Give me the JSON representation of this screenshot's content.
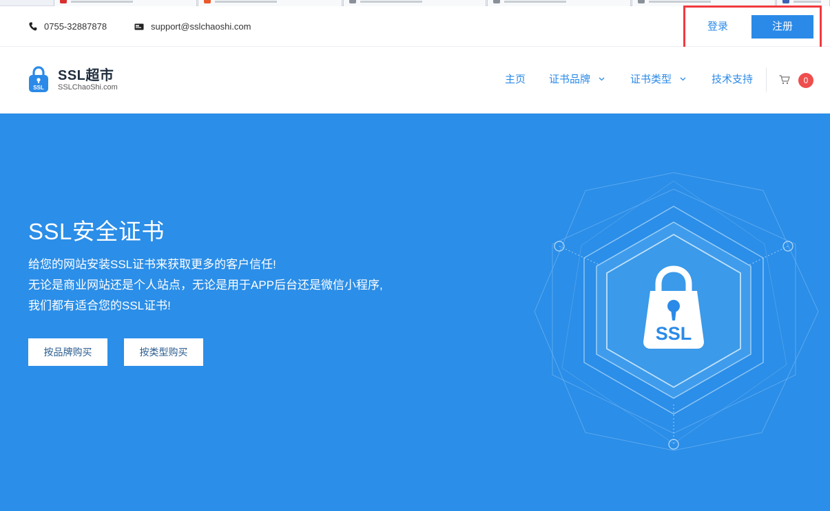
{
  "topbar": {
    "phone": "0755-32887878",
    "email": "support@sslchaoshi.com",
    "login_label": "登录",
    "register_label": "注册"
  },
  "brand": {
    "logo_badge": "SSL",
    "title": "SSL超市",
    "subtitle": "SSLChaoShi.com"
  },
  "nav": {
    "items": [
      {
        "label": "主页"
      },
      {
        "label": "证书品牌"
      },
      {
        "label": "证书类型"
      },
      {
        "label": "技术支持"
      }
    ],
    "cart_count": "0"
  },
  "hero": {
    "title": "SSL安全证书",
    "lines": [
      "给您的网站安装SSL证书来获取更多的客户信任!",
      "无论是商业网站还是个人站点，无论是用于APP后台还是微信小程序,",
      "我们都有适合您的SSL证书!"
    ],
    "buy_by_brand": "按品牌购买",
    "buy_by_type": "按类型购买",
    "lock_label": "SSL"
  },
  "colors": {
    "accent": "#2b8ae8",
    "hero_bg": "#2b8ee8",
    "highlight_box": "#f03a3f",
    "badge": "#ef4e4e"
  },
  "icons": {
    "phone": "phone-icon",
    "email": "email-icon",
    "cart": "cart-icon",
    "chevron": "chevron-down-icon",
    "lock": "lock-icon"
  }
}
